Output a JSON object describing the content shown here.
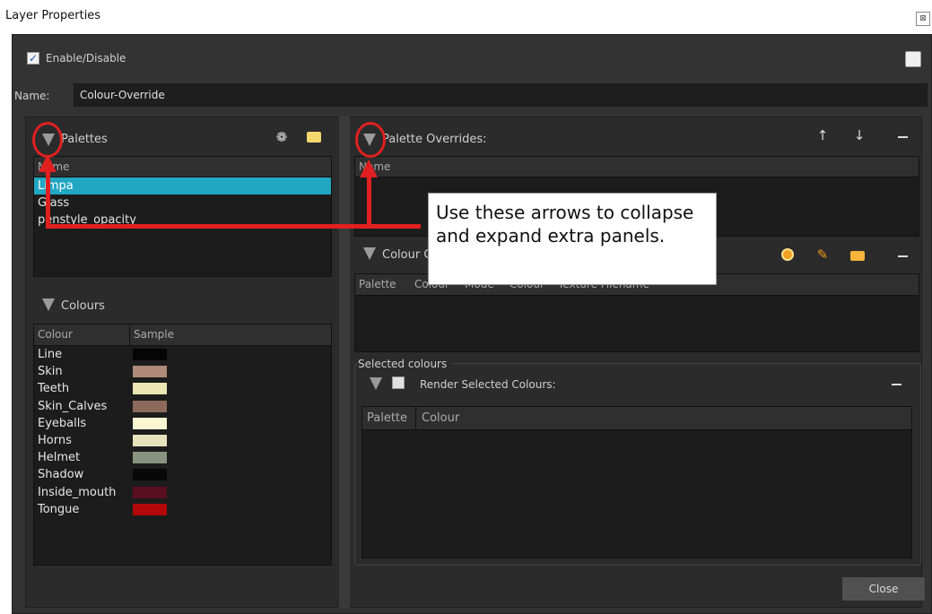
{
  "window": {
    "title": "Layer Properties",
    "close_glyph": "⊠"
  },
  "enable": {
    "label": "Enable/Disable",
    "checked": true
  },
  "name_field": {
    "label": "Name:",
    "value": "Colour-Override"
  },
  "palettes": {
    "title": "Palettes",
    "column": "Name",
    "items": [
      "Limpa",
      "Glass",
      "penstyle_opacity"
    ],
    "selected_index": 0
  },
  "colours": {
    "title": "Colours",
    "columns": [
      "Colour",
      "Sample"
    ],
    "items": [
      {
        "name": "Line",
        "color": "#050505"
      },
      {
        "name": "Skin",
        "color": "#b08a78"
      },
      {
        "name": "Teeth",
        "color": "#ece5b4"
      },
      {
        "name": "Skin_Calves",
        "color": "#8c6a5c"
      },
      {
        "name": "Eyeballs",
        "color": "#fbf6d2"
      },
      {
        "name": "Horns",
        "color": "#e6e2bc"
      },
      {
        "name": "Helmet",
        "color": "#8a9280"
      },
      {
        "name": "Shadow",
        "color": "#080808"
      },
      {
        "name": "Inside_mouth",
        "color": "#5a0e22"
      },
      {
        "name": "Tongue",
        "color": "#b20808"
      }
    ]
  },
  "palette_overrides": {
    "title": "Palette Overrides:",
    "column": "Name"
  },
  "colour_overrides": {
    "title_visible": "Colour C",
    "columns": [
      "Palette",
      "Colour",
      "Mode",
      "Colour",
      "Texture Filename"
    ]
  },
  "selected_colours": {
    "group_label": "Selected colours",
    "render_label": "Render Selected Colours:",
    "columns": [
      "Palette",
      "Colour"
    ]
  },
  "callout": {
    "text": "Use these arrows to collapse and expand extra panels."
  },
  "buttons": {
    "close": "Close"
  },
  "accent": {
    "selection": "#22a7c3",
    "annotation": "#e02020"
  }
}
